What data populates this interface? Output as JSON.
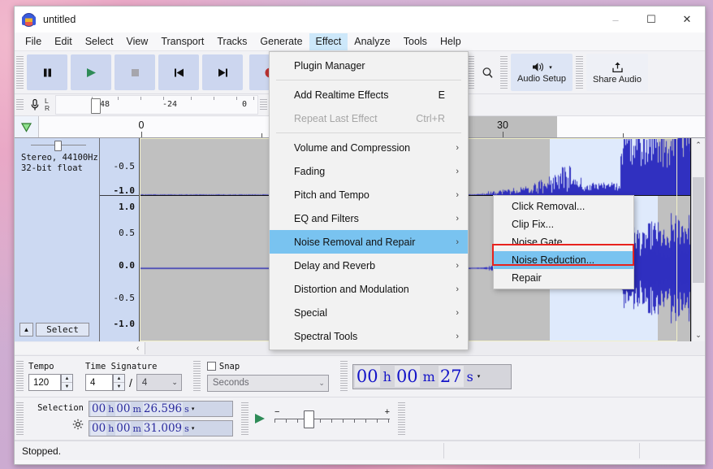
{
  "window": {
    "title": "untitled",
    "app_icon": "audacity-logo-icon",
    "minimize": "–",
    "maximize": "☐",
    "close": "✕"
  },
  "menubar": {
    "items": [
      {
        "label": "File",
        "active": false
      },
      {
        "label": "Edit",
        "active": false
      },
      {
        "label": "Select",
        "active": false
      },
      {
        "label": "View",
        "active": false
      },
      {
        "label": "Transport",
        "active": false
      },
      {
        "label": "Tracks",
        "active": false
      },
      {
        "label": "Generate",
        "active": false
      },
      {
        "label": "Effect",
        "active": true
      },
      {
        "label": "Analyze",
        "active": false
      },
      {
        "label": "Tools",
        "active": false
      },
      {
        "label": "Help",
        "active": false
      }
    ]
  },
  "toolbar": {
    "transport": [
      {
        "name": "pause-button",
        "icon": "pause-icon"
      },
      {
        "name": "play-button",
        "icon": "play-icon"
      },
      {
        "name": "stop-button",
        "icon": "stop-icon"
      },
      {
        "name": "skip-start-button",
        "icon": "skip-to-start-icon"
      },
      {
        "name": "skip-end-button",
        "icon": "skip-to-end-icon"
      },
      {
        "name": "record-button",
        "icon": "record-icon"
      }
    ],
    "zoom_in": "⌕",
    "undo": "↶",
    "audio_setup": {
      "label": "Audio Setup",
      "icon": "speaker-icon",
      "caret": "▾"
    },
    "share_audio": {
      "label": "Share Audio",
      "icon": "upload-icon"
    }
  },
  "meter": {
    "record_icon": "microphone-icon",
    "playback_icon": "speaker-icon",
    "channel_top": "L",
    "channel_bottom": "R",
    "ticks": [
      "-48",
      "-24",
      "0"
    ]
  },
  "timeline": {
    "pin_icon": "pinned-play-head-icon",
    "labels": [
      "0",
      "30"
    ],
    "selection_label": "30"
  },
  "track": {
    "info_line1": "Stereo, 44100Hz",
    "info_line2": "32-bit float",
    "select_button": "Select",
    "collapse_icon": "collapse-up-icon",
    "vertical_ruler_top": [
      "-0.5",
      "-1.0"
    ],
    "vertical_ruler_bottom": [
      "1.0",
      "0.5",
      "0.0",
      "-0.5",
      "-1.0"
    ]
  },
  "scrollbars": {
    "v_up": "⌃",
    "v_down": "⌄",
    "h_grip": "‹"
  },
  "effect_menu": {
    "items": [
      {
        "label": "Plugin Manager",
        "accel": "",
        "submenu": false,
        "disabled": false,
        "highlight": false,
        "sep_after": true
      },
      {
        "label": "Add Realtime Effects",
        "accel": "E",
        "submenu": false,
        "disabled": false,
        "highlight": false,
        "sep_after": false
      },
      {
        "label": "Repeat Last Effect",
        "accel": "Ctrl+R",
        "submenu": false,
        "disabled": true,
        "highlight": false,
        "sep_after": true
      },
      {
        "label": "Volume and Compression",
        "accel": "",
        "submenu": true,
        "disabled": false,
        "highlight": false,
        "sep_after": false
      },
      {
        "label": "Fading",
        "accel": "",
        "submenu": true,
        "disabled": false,
        "highlight": false,
        "sep_after": false
      },
      {
        "label": "Pitch and Tempo",
        "accel": "",
        "submenu": true,
        "disabled": false,
        "highlight": false,
        "sep_after": false
      },
      {
        "label": "EQ and Filters",
        "accel": "",
        "submenu": true,
        "disabled": false,
        "highlight": false,
        "sep_after": false
      },
      {
        "label": "Noise Removal and Repair",
        "accel": "",
        "submenu": true,
        "disabled": false,
        "highlight": true,
        "sep_after": false
      },
      {
        "label": "Delay and Reverb",
        "accel": "",
        "submenu": true,
        "disabled": false,
        "highlight": false,
        "sep_after": false
      },
      {
        "label": "Distortion and Modulation",
        "accel": "",
        "submenu": true,
        "disabled": false,
        "highlight": false,
        "sep_after": false
      },
      {
        "label": "Special",
        "accel": "",
        "submenu": true,
        "disabled": false,
        "highlight": false,
        "sep_after": false
      },
      {
        "label": "Spectral Tools",
        "accel": "",
        "submenu": true,
        "disabled": false,
        "highlight": false,
        "sep_after": false
      }
    ]
  },
  "noise_submenu": {
    "items": [
      {
        "label": "Click Removal...",
        "highlight": false
      },
      {
        "label": "Clip Fix...",
        "highlight": false
      },
      {
        "label": "Noise Gate...",
        "highlight": false
      },
      {
        "label": "Noise Reduction...",
        "highlight": true
      },
      {
        "label": "Repair",
        "highlight": false
      }
    ]
  },
  "bottom_bar": {
    "tempo_label": "Tempo",
    "tempo_value": "120",
    "time_signature_label": "Time Signature",
    "time_sig_upper": "4",
    "time_sig_divider": "/",
    "time_sig_lower": "4",
    "snap_label": "Snap",
    "snap_checked": false,
    "snap_mode": "Seconds",
    "audio_position": {
      "hours": "00",
      "h": "h",
      "minutes": "00",
      "m": "m",
      "seconds": "27",
      "s": "s"
    }
  },
  "selection_bar": {
    "label": "Selection",
    "gear_icon": "gear-icon",
    "start": {
      "hours": "00",
      "h": "h",
      "minutes": "00",
      "m": "m",
      "seconds": "26.596",
      "s": "s"
    },
    "end": {
      "hours": "00",
      "h": "h",
      "minutes": "00",
      "m": "m",
      "seconds": "31.009",
      "s": "s"
    },
    "play_icon": "play-at-speed-icon",
    "speed_minus": "−",
    "speed_plus": "+"
  },
  "statusbar": {
    "message": "Stopped."
  },
  "colors": {
    "menu_highlight": "#79c3f0",
    "red_callout": "#e8231e",
    "waveform": "#3030c0",
    "track_background": "#c0c0c0",
    "selection_band": "#dfeafc",
    "panel_blue": "#ccd9f2",
    "transport_button": "#ccd6ef",
    "time_digits": "#1414c8"
  }
}
